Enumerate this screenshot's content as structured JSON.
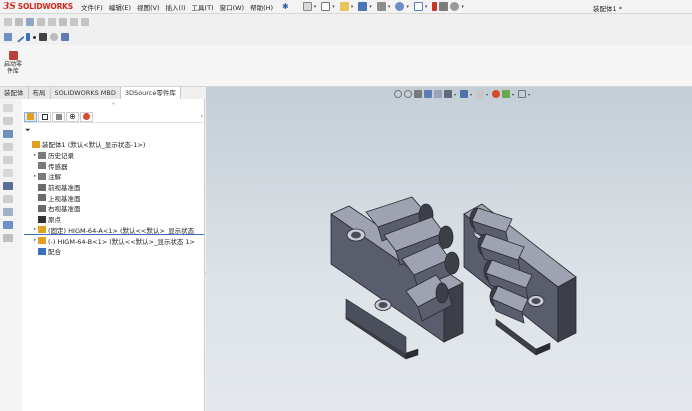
{
  "app": {
    "brand_ds": "3S",
    "brand_name": "SOLIDWORKS",
    "document_title": "装配体1 *"
  },
  "menu": {
    "items": [
      {
        "label": "文件(F)"
      },
      {
        "label": "编辑(E)"
      },
      {
        "label": "视图(V)"
      },
      {
        "label": "插入(I)"
      },
      {
        "label": "工具(T)"
      },
      {
        "label": "窗口(W)"
      },
      {
        "label": "帮助(H)"
      }
    ]
  },
  "command_manager": {
    "start_button_line1": "启动零",
    "start_button_line2": "件库"
  },
  "tabs": [
    {
      "label": "装配体",
      "active": false
    },
    {
      "label": "布局",
      "active": false
    },
    {
      "label": "SOLIDWORKS MBD",
      "active": false
    },
    {
      "label": "3DSource零件库",
      "active": true
    }
  ],
  "feature_tree": {
    "items": [
      {
        "label": "装配体1 (默认<默认_显示状态-1>)",
        "indent": 0,
        "expander": "",
        "icon_color": "#e0a020"
      },
      {
        "label": "历史记录",
        "indent": 1,
        "expander": "▸",
        "icon_color": "#7a7a7a"
      },
      {
        "label": "传感器",
        "indent": 1,
        "expander": "",
        "icon_color": "#7a7a7a"
      },
      {
        "label": "注解",
        "indent": 1,
        "expander": "▸",
        "icon_color": "#7a7a7a"
      },
      {
        "label": "前视基准面",
        "indent": 1,
        "expander": "",
        "icon_color": "#6a6a6a"
      },
      {
        "label": "上视基准面",
        "indent": 1,
        "expander": "",
        "icon_color": "#6a6a6a"
      },
      {
        "label": "右视基准面",
        "indent": 1,
        "expander": "",
        "icon_color": "#6a6a6a"
      },
      {
        "label": "原点",
        "indent": 1,
        "expander": "",
        "icon_color": "#333333"
      },
      {
        "label": "(固定) HIGM-64-A<1> (默认<<默认>_显示状态",
        "indent": 1,
        "expander": "▸",
        "icon_color": "#e0a020"
      },
      {
        "label": "(-) HIGM-64-B<1> (默认<<默认>_显示状态 1>",
        "indent": 1,
        "expander": "▸",
        "icon_color": "#e0a020"
      },
      {
        "label": "配合",
        "indent": 1,
        "expander": "",
        "icon_color": "#3a6fbf"
      }
    ]
  },
  "colors": {
    "accent": "#3a6fbf",
    "brand": "#d4261c",
    "part_top": "#9fa3b1",
    "part_front": "#5a5d6b",
    "part_side": "#3c3e48"
  },
  "icons": {
    "pin": "pin-icon",
    "filter": "filter-icon"
  }
}
